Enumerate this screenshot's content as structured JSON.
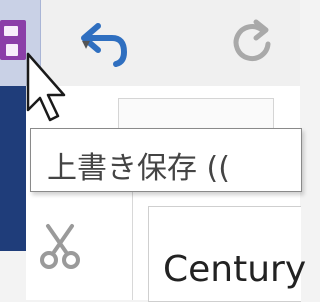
{
  "toolbar": {
    "save_label": "上書き保存",
    "undo_dropdown_glyph": "▾"
  },
  "tooltip": {
    "text": "上書き保存 (("
  },
  "font": {
    "name": "Century"
  },
  "colors": {
    "save_highlight": "#c9d1e6",
    "save_icon": "#8b3fa8",
    "undo_arrow": "#2f6fc0",
    "left_panel": "#1f3d7a"
  },
  "icons": [
    "save-icon",
    "undo-icon",
    "dropdown-arrow-icon",
    "redo-icon",
    "cut-icon",
    "cursor-icon"
  ]
}
